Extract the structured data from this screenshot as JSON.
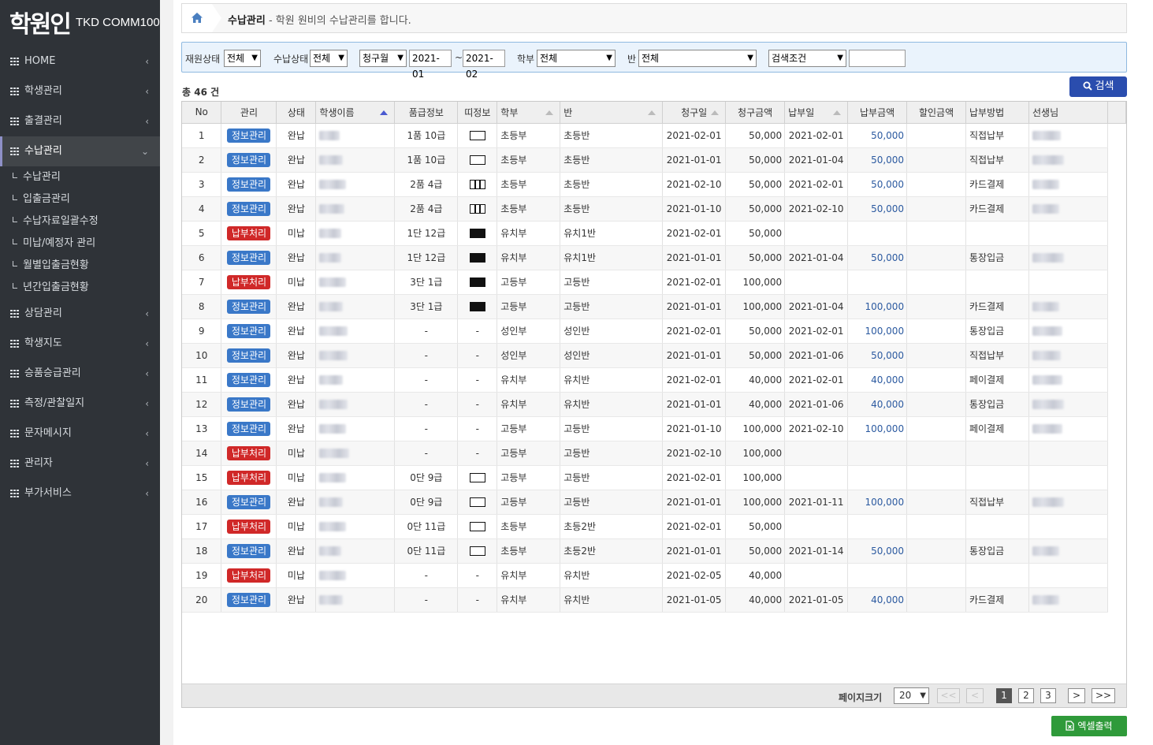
{
  "logo": {
    "main": "학원인",
    "sub": "TKD COMM100"
  },
  "sidebar": {
    "items": [
      {
        "label": "HOME",
        "chev": "‹"
      },
      {
        "label": "학생관리",
        "chev": "‹"
      },
      {
        "label": "출결관리",
        "chev": "‹"
      },
      {
        "label": "수납관리",
        "chev": "⌄"
      },
      {
        "label": "상담관리",
        "chev": "‹"
      },
      {
        "label": "학생지도",
        "chev": "‹"
      },
      {
        "label": "승품승급관리",
        "chev": "‹"
      },
      {
        "label": "측정/관찰일지",
        "chev": "‹"
      },
      {
        "label": "문자메시지",
        "chev": "‹"
      },
      {
        "label": "관리자",
        "chev": "‹"
      },
      {
        "label": "부가서비스",
        "chev": "‹"
      }
    ],
    "subitems": [
      "수납관리",
      "입출금관리",
      "수납자료일괄수정",
      "미납/예정자 관리",
      "월별입출금현황",
      "년간입출금현황"
    ]
  },
  "header": {
    "title": "수납관리",
    "desc": " - 학원 원비의 수납관리를 합니다."
  },
  "filter": {
    "enroll_label": "재원상태",
    "enroll_value": "전체",
    "pay_label": "수납상태",
    "pay_value": "전체",
    "month_type": "청구월",
    "from": "2021-01",
    "tilde": "~",
    "to": "2021-02",
    "dept_label": "학부",
    "dept_value": "전체",
    "class_label": "반",
    "class_value": "전체",
    "cond_value": "검색조건",
    "keyword": ""
  },
  "total": {
    "prefix": "총",
    "count": "46",
    "suffix": "건"
  },
  "search_button": "검색",
  "table": {
    "headers": [
      "No",
      "관리",
      "상태",
      "학생이름",
      "품급정보",
      "띠정보",
      "학부",
      "반",
      "청구일",
      "청구금액",
      "납부일",
      "납부금액",
      "할인금액",
      "납부방법",
      "선생님"
    ],
    "rows": [
      {
        "no": "1",
        "action": "정보관리",
        "type": "b",
        "status": "완납",
        "rank": "1품 10급",
        "belt": "white",
        "dept": "초등부",
        "cls": "초등반",
        "billdate": "2021-02-01",
        "billamt": "50,000",
        "paydate": "2021-02-01",
        "payamt": "50,000",
        "disc": "",
        "method": "직접납부",
        "teacher": true
      },
      {
        "no": "2",
        "action": "정보관리",
        "type": "b",
        "status": "완납",
        "rank": "1품 10급",
        "belt": "white",
        "dept": "초등부",
        "cls": "초등반",
        "billdate": "2021-01-01",
        "billamt": "50,000",
        "paydate": "2021-01-04",
        "payamt": "50,000",
        "disc": "",
        "method": "직접납부",
        "teacher": true
      },
      {
        "no": "3",
        "action": "정보관리",
        "type": "b",
        "status": "완납",
        "rank": "2품 4급",
        "belt": "stripe",
        "dept": "초등부",
        "cls": "초등반",
        "billdate": "2021-02-10",
        "billamt": "50,000",
        "paydate": "2021-02-01",
        "payamt": "50,000",
        "disc": "",
        "method": "카드결제",
        "teacher": true
      },
      {
        "no": "4",
        "action": "정보관리",
        "type": "b",
        "status": "완납",
        "rank": "2품 4급",
        "belt": "stripe",
        "dept": "초등부",
        "cls": "초등반",
        "billdate": "2021-01-10",
        "billamt": "50,000",
        "paydate": "2021-02-10",
        "payamt": "50,000",
        "disc": "",
        "method": "카드결제",
        "teacher": true
      },
      {
        "no": "5",
        "action": "납부처리",
        "type": "r",
        "status": "미납",
        "rank": "1단 12급",
        "belt": "black",
        "dept": "유치부",
        "cls": "유치1반",
        "billdate": "2021-02-01",
        "billamt": "50,000",
        "paydate": "",
        "payamt": "",
        "disc": "",
        "method": "",
        "teacher": false
      },
      {
        "no": "6",
        "action": "정보관리",
        "type": "b",
        "status": "완납",
        "rank": "1단 12급",
        "belt": "black",
        "dept": "유치부",
        "cls": "유치1반",
        "billdate": "2021-01-01",
        "billamt": "50,000",
        "paydate": "2021-01-04",
        "payamt": "50,000",
        "disc": "",
        "method": "통장입금",
        "teacher": true
      },
      {
        "no": "7",
        "action": "납부처리",
        "type": "r",
        "status": "미납",
        "rank": "3단 1급",
        "belt": "black",
        "dept": "고등부",
        "cls": "고등반",
        "billdate": "2021-02-01",
        "billamt": "100,000",
        "paydate": "",
        "payamt": "",
        "disc": "",
        "method": "",
        "teacher": false
      },
      {
        "no": "8",
        "action": "정보관리",
        "type": "b",
        "status": "완납",
        "rank": "3단 1급",
        "belt": "black",
        "dept": "고등부",
        "cls": "고등반",
        "billdate": "2021-01-01",
        "billamt": "100,000",
        "paydate": "2021-01-04",
        "payamt": "100,000",
        "disc": "",
        "method": "카드결제",
        "teacher": true
      },
      {
        "no": "9",
        "action": "정보관리",
        "type": "b",
        "status": "완납",
        "rank": "-",
        "belt": "-",
        "dept": "성인부",
        "cls": "성인반",
        "billdate": "2021-02-01",
        "billamt": "50,000",
        "paydate": "2021-02-01",
        "payamt": "100,000",
        "disc": "",
        "method": "통장입금",
        "teacher": true
      },
      {
        "no": "10",
        "action": "정보관리",
        "type": "b",
        "status": "완납",
        "rank": "-",
        "belt": "-",
        "dept": "성인부",
        "cls": "성인반",
        "billdate": "2021-01-01",
        "billamt": "50,000",
        "paydate": "2021-01-06",
        "payamt": "50,000",
        "disc": "",
        "method": "직접납부",
        "teacher": true
      },
      {
        "no": "11",
        "action": "정보관리",
        "type": "b",
        "status": "완납",
        "rank": "-",
        "belt": "-",
        "dept": "유치부",
        "cls": "유치반",
        "billdate": "2021-02-01",
        "billamt": "40,000",
        "paydate": "2021-02-01",
        "payamt": "40,000",
        "disc": "",
        "method": "페이결제",
        "teacher": true
      },
      {
        "no": "12",
        "action": "정보관리",
        "type": "b",
        "status": "완납",
        "rank": "-",
        "belt": "-",
        "dept": "유치부",
        "cls": "유치반",
        "billdate": "2021-01-01",
        "billamt": "40,000",
        "paydate": "2021-01-06",
        "payamt": "40,000",
        "disc": "",
        "method": "통장입금",
        "teacher": true
      },
      {
        "no": "13",
        "action": "정보관리",
        "type": "b",
        "status": "완납",
        "rank": "-",
        "belt": "-",
        "dept": "고등부",
        "cls": "고등반",
        "billdate": "2021-01-10",
        "billamt": "100,000",
        "paydate": "2021-02-10",
        "payamt": "100,000",
        "disc": "",
        "method": "페이결제",
        "teacher": true
      },
      {
        "no": "14",
        "action": "납부처리",
        "type": "r",
        "status": "미납",
        "rank": "-",
        "belt": "-",
        "dept": "고등부",
        "cls": "고등반",
        "billdate": "2021-02-10",
        "billamt": "100,000",
        "paydate": "",
        "payamt": "",
        "disc": "",
        "method": "",
        "teacher": false
      },
      {
        "no": "15",
        "action": "납부처리",
        "type": "r",
        "status": "미납",
        "rank": "0단 9급",
        "belt": "white",
        "dept": "고등부",
        "cls": "고등반",
        "billdate": "2021-02-01",
        "billamt": "100,000",
        "paydate": "",
        "payamt": "",
        "disc": "",
        "method": "",
        "teacher": false
      },
      {
        "no": "16",
        "action": "정보관리",
        "type": "b",
        "status": "완납",
        "rank": "0단 9급",
        "belt": "white",
        "dept": "고등부",
        "cls": "고등반",
        "billdate": "2021-01-01",
        "billamt": "100,000",
        "paydate": "2021-01-11",
        "payamt": "100,000",
        "disc": "",
        "method": "직접납부",
        "teacher": true
      },
      {
        "no": "17",
        "action": "납부처리",
        "type": "r",
        "status": "미납",
        "rank": "0단 11급",
        "belt": "white",
        "dept": "초등부",
        "cls": "초등2반",
        "billdate": "2021-02-01",
        "billamt": "50,000",
        "paydate": "",
        "payamt": "",
        "disc": "",
        "method": "",
        "teacher": false
      },
      {
        "no": "18",
        "action": "정보관리",
        "type": "b",
        "status": "완납",
        "rank": "0단 11급",
        "belt": "white",
        "dept": "초등부",
        "cls": "초등2반",
        "billdate": "2021-01-01",
        "billamt": "50,000",
        "paydate": "2021-01-14",
        "payamt": "50,000",
        "disc": "",
        "method": "통장입금",
        "teacher": true
      },
      {
        "no": "19",
        "action": "납부처리",
        "type": "r",
        "status": "미납",
        "rank": "-",
        "belt": "-",
        "dept": "유치부",
        "cls": "유치반",
        "billdate": "2021-02-05",
        "billamt": "40,000",
        "paydate": "",
        "payamt": "",
        "disc": "",
        "method": "",
        "teacher": false
      },
      {
        "no": "20",
        "action": "정보관리",
        "type": "b",
        "status": "완납",
        "rank": "-",
        "belt": "-",
        "dept": "유치부",
        "cls": "유치반",
        "billdate": "2021-01-05",
        "billamt": "40,000",
        "paydate": "2021-01-05",
        "payamt": "40,000",
        "disc": "",
        "method": "카드결제",
        "teacher": true
      }
    ]
  },
  "pager": {
    "size_label": "페이지크기",
    "size_value": "20",
    "first": "<<",
    "prev": "<",
    "pages": [
      "1",
      "2",
      "3"
    ],
    "current": "1",
    "next": ">",
    "last": ">>"
  },
  "excel_button": "엑셀출력",
  "colors": {
    "sidebar_bg": "#2f3338",
    "primary": "#2a4dae",
    "info_button": "#3a78c8",
    "danger_button": "#d02828",
    "excel": "#2f9a3a"
  }
}
